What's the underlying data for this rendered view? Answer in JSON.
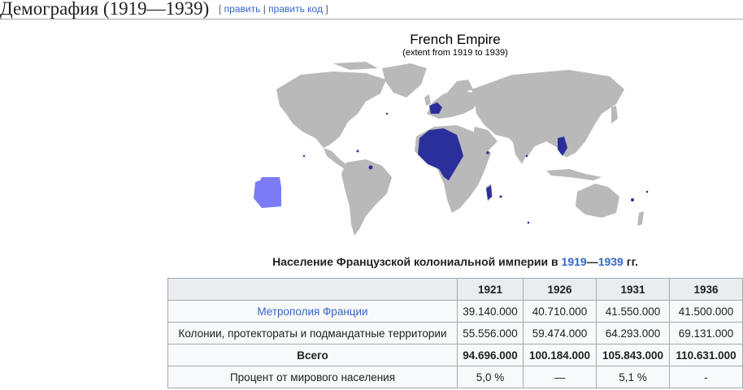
{
  "section": {
    "title": "Демография (1919—1939)",
    "edit_open": "[",
    "edit_label": "править",
    "edit_sep": "|",
    "edit_code_label": "править код",
    "edit_close": "]"
  },
  "map": {
    "title": "French Empire",
    "subtitle": "(extent from 1919 to 1939)",
    "colors": {
      "land": "#b9b9b9",
      "french": "#2b2f9b",
      "mandate": "#7b7cf5",
      "ocean": "#ffffff"
    }
  },
  "caption": {
    "prefix": "Население Французской колониальной империи в",
    "year_start": "1919",
    "dash": "—",
    "year_end": "1939",
    "suffix": "гг."
  },
  "table": {
    "headers": [
      "",
      "1921",
      "1926",
      "1931",
      "1936"
    ],
    "rows": [
      {
        "label": "Метрополия Франции",
        "values": [
          "39.140.000",
          "40.710.000",
          "41.550.000",
          "41.500.000"
        ]
      },
      {
        "label": "Колонии, протектораты и подмандатные территории",
        "values": [
          "55.556.000",
          "59.474.000",
          "64.293.000",
          "69.131.000"
        ]
      },
      {
        "label": "Всего",
        "values": [
          "94.696.000",
          "100.184.000",
          "105.843.000",
          "110.631.000"
        ]
      },
      {
        "label": "Процент от мирового населения",
        "values": [
          "5,0 %",
          "—",
          "5,1 %",
          "-"
        ]
      }
    ]
  }
}
